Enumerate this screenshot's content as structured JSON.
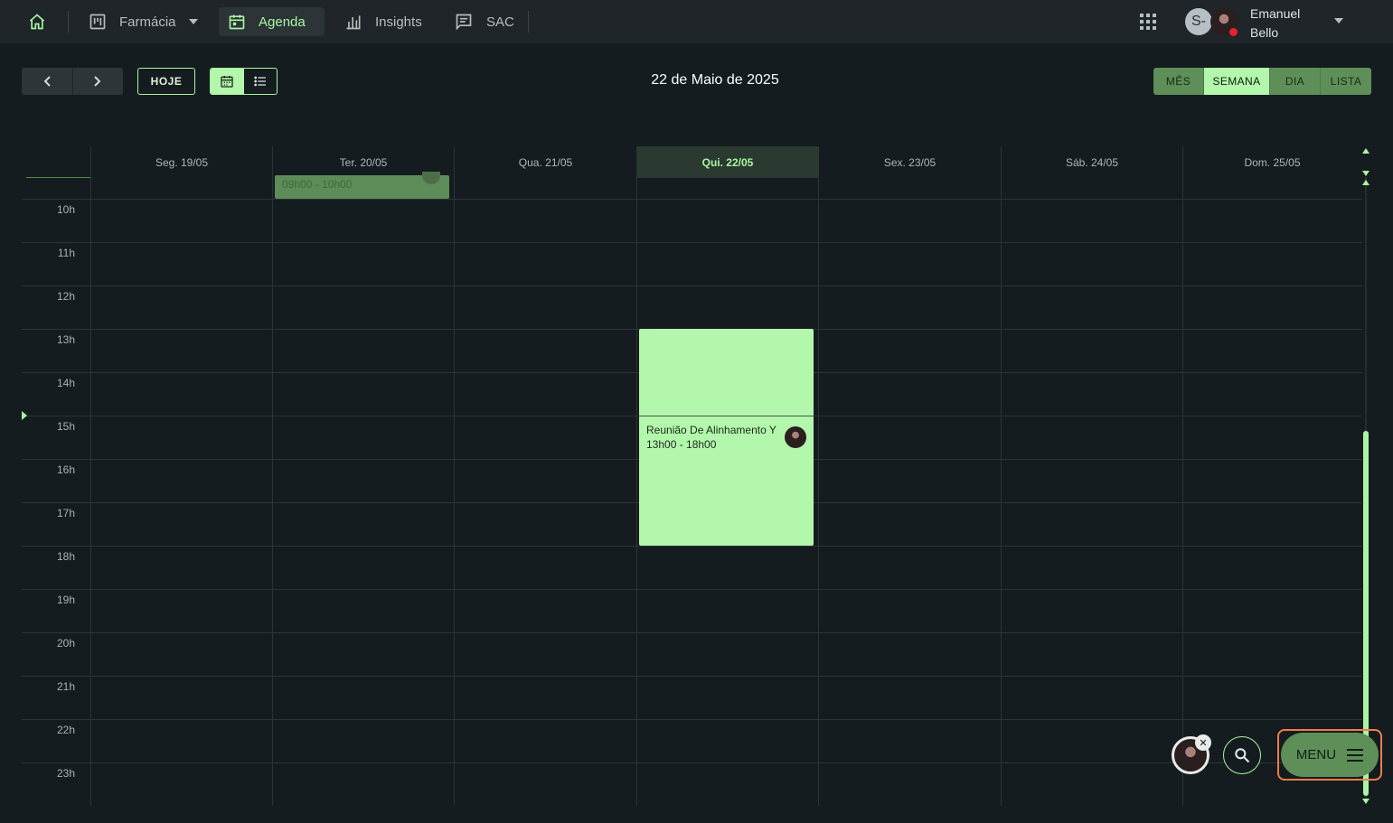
{
  "nav": {
    "org": "Farmácia",
    "items": [
      {
        "label": "Agenda",
        "icon": "calendar-icon",
        "active": true
      },
      {
        "label": "Insights",
        "icon": "bar-chart-icon"
      },
      {
        "label": "SAC",
        "icon": "chat-icon"
      }
    ],
    "user": {
      "initial": "S-",
      "name": "Emanuel Bello",
      "status_color": "#e8232d"
    }
  },
  "toolbar": {
    "today_label": "HOJE",
    "current_date": "22 de Maio de 2025",
    "views": [
      {
        "label": "MÊS",
        "selected": false
      },
      {
        "label": "SEMANA",
        "selected": true
      },
      {
        "label": "DIA",
        "selected": false
      },
      {
        "label": "LISTA",
        "selected": false
      }
    ]
  },
  "calendar": {
    "days": [
      {
        "label": "Seg. 19/05",
        "today": false
      },
      {
        "label": "Ter. 20/05",
        "today": false
      },
      {
        "label": "Qua. 21/05",
        "today": false
      },
      {
        "label": "Qui. 22/05",
        "today": true
      },
      {
        "label": "Sex. 23/05",
        "today": false
      },
      {
        "label": "Sáb. 24/05",
        "today": false
      },
      {
        "label": "Dom. 25/05",
        "today": false
      }
    ],
    "hours": [
      "10h",
      "11h",
      "12h",
      "13h",
      "14h",
      "15h",
      "16h",
      "17h",
      "18h",
      "19h",
      "20h",
      "21h",
      "22h",
      "23h"
    ],
    "events": [
      {
        "day": "Ter. 20/05",
        "time": "09h00 - 10h00"
      },
      {
        "day": "Qui. 22/05",
        "title": "Reunião De Alinhamento Y",
        "time": "13h00 - 18h00"
      }
    ]
  },
  "fab": {
    "menu_label": "MENU",
    "close_glyph": "✕"
  },
  "colors": {
    "accent": "#a8f5a2",
    "accent_dark": "#5e8f59",
    "bg": "#151c1f",
    "highlight": "#f07c4a"
  }
}
